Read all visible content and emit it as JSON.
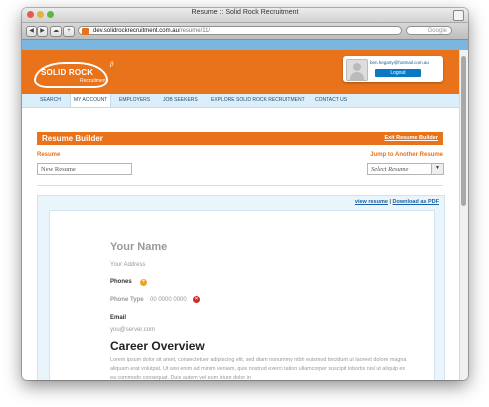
{
  "browser": {
    "window_title": "Resume :: Solid Rock Recruitment",
    "url_host": "dev.solidrockrecruitment.com.au",
    "url_path": "/resume/11/",
    "search_placeholder": "Google"
  },
  "site": {
    "logo_text": "SOLID ROCK",
    "logo_sub": "Recruitment",
    "logo_mark": "β",
    "user_email": "ben.hegarty@hotmail.com.au",
    "logout_label": "Logout"
  },
  "nav": {
    "items": [
      {
        "label": "SEARCH"
      },
      {
        "label": "MY ACCOUNT",
        "active": true
      },
      {
        "label": "EMPLOYERS"
      },
      {
        "label": "JOB SEEKERS"
      },
      {
        "label": "EXPLORE SOLID ROCK RECRUITMENT"
      },
      {
        "label": "CONTACT US"
      }
    ]
  },
  "builder": {
    "title": "Resume Builder",
    "exit_label": "Exit Resume Builder",
    "resume_label": "Resume",
    "jump_label": "Jump to Another Resume",
    "new_resume_value": "New Resume",
    "select_placeholder": "Select Resume",
    "view_resume_link": "view resume",
    "download_pdf_link": "Download as PDF",
    "link_separator": "|"
  },
  "resume": {
    "name": "Your Name",
    "address": "Your Address",
    "phones_label": "Phones",
    "phone_type": "Phone Type",
    "phone_number": "00 0000 0000",
    "email_label": "Email",
    "email_value": "you@server.com",
    "career_heading": "Career Overview",
    "career_text": "Lorem ipsum dolor sit amet, consectetuer adipiscing elit, sed diam nonummy nibh euismod tincidunt ut laoreet dolore magna aliquam erat volutpat. Ut wisi enim ad minim veniam, quis nostrud exerci tation ullamcorper suscipit lobortis nisl ut aliquip ex ea commodo consequat. Duis autem vel eum iriure dolor in"
  },
  "colors": {
    "brand_orange": "#e8731a",
    "nav_bg": "#dceefa",
    "link_blue": "#1a60a6"
  }
}
